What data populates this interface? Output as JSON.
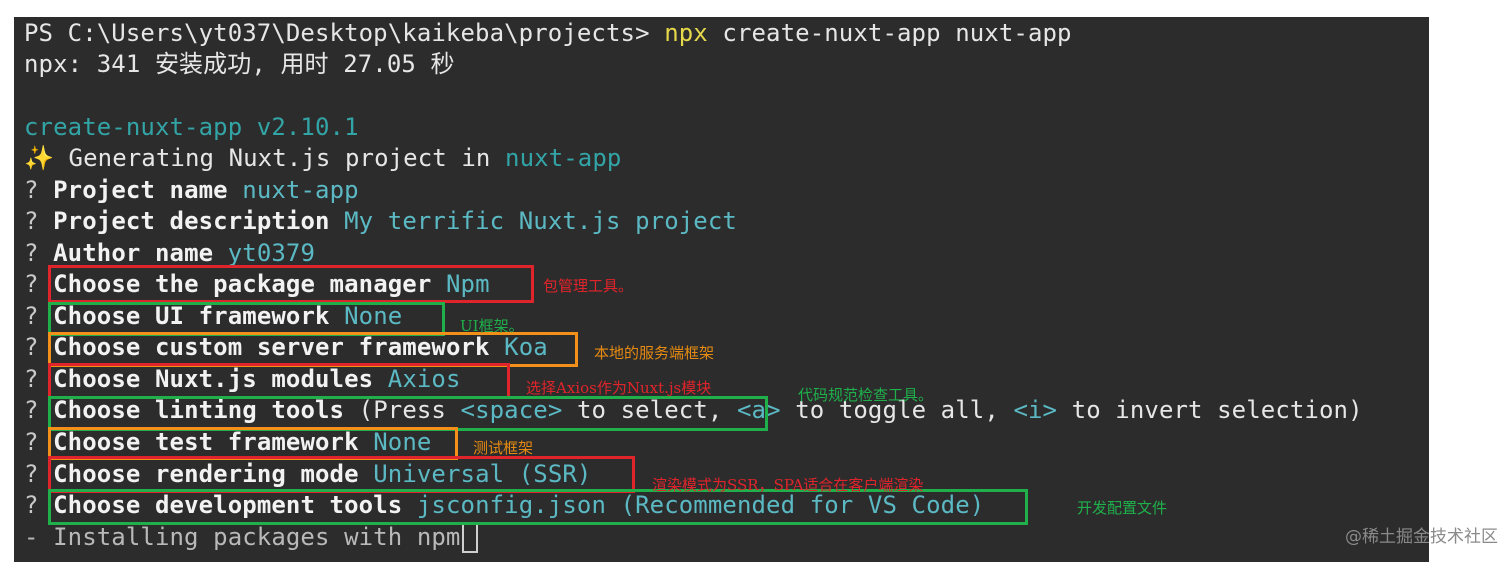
{
  "terminal": {
    "prompt": "PS C:\\Users\\yt037\\Desktop\\kaikeba\\projects>",
    "cmd_npx": "npx",
    "cmd_rest": "create-nuxt-app nuxt-app",
    "npx_line": "npx: 341 安装成功, 用时 27.05 秒",
    "version": "create-nuxt-app v2.10.1",
    "sparkle": "✨",
    "generating_text": "Generating Nuxt.js project in",
    "generating_value": "nuxt-app",
    "q_mark": "?",
    "questions": [
      {
        "label": "Project name",
        "value": "nuxt-app"
      },
      {
        "label": "Project description",
        "value": "My terrific Nuxt.js project"
      },
      {
        "label": "Author name",
        "value": "yt0379"
      },
      {
        "label": "Choose the package manager",
        "value": "Npm"
      },
      {
        "label": "Choose UI framework",
        "value": "None"
      },
      {
        "label": "Choose custom server framework",
        "value": "Koa"
      },
      {
        "label": "Choose Nuxt.js modules",
        "value": "Axios"
      },
      {
        "label": "Choose linting tools",
        "value": ""
      },
      {
        "label": "Choose test framework",
        "value": "None"
      },
      {
        "label": "Choose rendering mode",
        "value": "Universal (SSR)"
      },
      {
        "label": "Choose development tools",
        "value": "jsconfig.json (Recommended for VS Code)"
      }
    ],
    "lint_hint": {
      "p1": "(Press ",
      "k1": "<space>",
      "p2": " to select, ",
      "k2": "<a>",
      "p3": " to toggle all, ",
      "k3": "<i>",
      "p4": " to invert selection)"
    },
    "installing": "- Installing packages with npm"
  },
  "annotations": {
    "package_manager": "包管理工具。",
    "ui_framework": "UI框架。",
    "server_framework": "本地的服务端框架",
    "modules": "选择Axios作为Nuxt.js模块",
    "linting": "代码规范检查工具。",
    "test_framework": "测试框架",
    "rendering": "渲染模式为SSR，SPA适合在客户端渲染",
    "dev_tools": "开发配置文件"
  },
  "watermark": "@稀土掘金技术社区",
  "colors": {
    "terminal_bg": "#2c2c2c",
    "red_box": "#e0242b",
    "green_box": "#1fb04b",
    "orange_box": "#f39019",
    "npx_yellow": "#e5d84a",
    "value_cyan": "#5bb9c4"
  }
}
